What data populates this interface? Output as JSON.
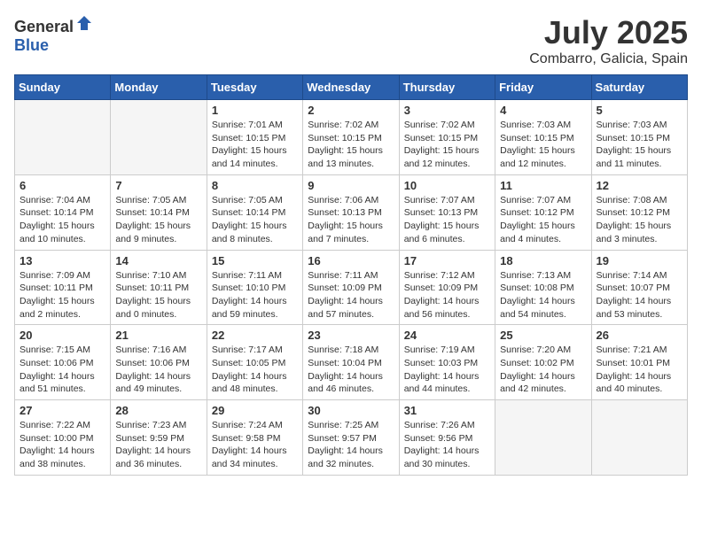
{
  "header": {
    "logo_general": "General",
    "logo_blue": "Blue",
    "month": "July 2025",
    "location": "Combarro, Galicia, Spain"
  },
  "weekdays": [
    "Sunday",
    "Monday",
    "Tuesday",
    "Wednesday",
    "Thursday",
    "Friday",
    "Saturday"
  ],
  "weeks": [
    [
      {
        "day": "",
        "empty": true
      },
      {
        "day": "",
        "empty": true
      },
      {
        "day": "1",
        "sunrise": "7:01 AM",
        "sunset": "10:15 PM",
        "daylight": "15 hours and 14 minutes."
      },
      {
        "day": "2",
        "sunrise": "7:02 AM",
        "sunset": "10:15 PM",
        "daylight": "15 hours and 13 minutes."
      },
      {
        "day": "3",
        "sunrise": "7:02 AM",
        "sunset": "10:15 PM",
        "daylight": "15 hours and 12 minutes."
      },
      {
        "day": "4",
        "sunrise": "7:03 AM",
        "sunset": "10:15 PM",
        "daylight": "15 hours and 12 minutes."
      },
      {
        "day": "5",
        "sunrise": "7:03 AM",
        "sunset": "10:15 PM",
        "daylight": "15 hours and 11 minutes."
      }
    ],
    [
      {
        "day": "6",
        "sunrise": "7:04 AM",
        "sunset": "10:14 PM",
        "daylight": "15 hours and 10 minutes."
      },
      {
        "day": "7",
        "sunrise": "7:05 AM",
        "sunset": "10:14 PM",
        "daylight": "15 hours and 9 minutes."
      },
      {
        "day": "8",
        "sunrise": "7:05 AM",
        "sunset": "10:14 PM",
        "daylight": "15 hours and 8 minutes."
      },
      {
        "day": "9",
        "sunrise": "7:06 AM",
        "sunset": "10:13 PM",
        "daylight": "15 hours and 7 minutes."
      },
      {
        "day": "10",
        "sunrise": "7:07 AM",
        "sunset": "10:13 PM",
        "daylight": "15 hours and 6 minutes."
      },
      {
        "day": "11",
        "sunrise": "7:07 AM",
        "sunset": "10:12 PM",
        "daylight": "15 hours and 4 minutes."
      },
      {
        "day": "12",
        "sunrise": "7:08 AM",
        "sunset": "10:12 PM",
        "daylight": "15 hours and 3 minutes."
      }
    ],
    [
      {
        "day": "13",
        "sunrise": "7:09 AM",
        "sunset": "10:11 PM",
        "daylight": "15 hours and 2 minutes."
      },
      {
        "day": "14",
        "sunrise": "7:10 AM",
        "sunset": "10:11 PM",
        "daylight": "15 hours and 0 minutes."
      },
      {
        "day": "15",
        "sunrise": "7:11 AM",
        "sunset": "10:10 PM",
        "daylight": "14 hours and 59 minutes."
      },
      {
        "day": "16",
        "sunrise": "7:11 AM",
        "sunset": "10:09 PM",
        "daylight": "14 hours and 57 minutes."
      },
      {
        "day": "17",
        "sunrise": "7:12 AM",
        "sunset": "10:09 PM",
        "daylight": "14 hours and 56 minutes."
      },
      {
        "day": "18",
        "sunrise": "7:13 AM",
        "sunset": "10:08 PM",
        "daylight": "14 hours and 54 minutes."
      },
      {
        "day": "19",
        "sunrise": "7:14 AM",
        "sunset": "10:07 PM",
        "daylight": "14 hours and 53 minutes."
      }
    ],
    [
      {
        "day": "20",
        "sunrise": "7:15 AM",
        "sunset": "10:06 PM",
        "daylight": "14 hours and 51 minutes."
      },
      {
        "day": "21",
        "sunrise": "7:16 AM",
        "sunset": "10:06 PM",
        "daylight": "14 hours and 49 minutes."
      },
      {
        "day": "22",
        "sunrise": "7:17 AM",
        "sunset": "10:05 PM",
        "daylight": "14 hours and 48 minutes."
      },
      {
        "day": "23",
        "sunrise": "7:18 AM",
        "sunset": "10:04 PM",
        "daylight": "14 hours and 46 minutes."
      },
      {
        "day": "24",
        "sunrise": "7:19 AM",
        "sunset": "10:03 PM",
        "daylight": "14 hours and 44 minutes."
      },
      {
        "day": "25",
        "sunrise": "7:20 AM",
        "sunset": "10:02 PM",
        "daylight": "14 hours and 42 minutes."
      },
      {
        "day": "26",
        "sunrise": "7:21 AM",
        "sunset": "10:01 PM",
        "daylight": "14 hours and 40 minutes."
      }
    ],
    [
      {
        "day": "27",
        "sunrise": "7:22 AM",
        "sunset": "10:00 PM",
        "daylight": "14 hours and 38 minutes."
      },
      {
        "day": "28",
        "sunrise": "7:23 AM",
        "sunset": "9:59 PM",
        "daylight": "14 hours and 36 minutes."
      },
      {
        "day": "29",
        "sunrise": "7:24 AM",
        "sunset": "9:58 PM",
        "daylight": "14 hours and 34 minutes."
      },
      {
        "day": "30",
        "sunrise": "7:25 AM",
        "sunset": "9:57 PM",
        "daylight": "14 hours and 32 minutes."
      },
      {
        "day": "31",
        "sunrise": "7:26 AM",
        "sunset": "9:56 PM",
        "daylight": "14 hours and 30 minutes."
      },
      {
        "day": "",
        "empty": true
      },
      {
        "day": "",
        "empty": true
      }
    ]
  ]
}
